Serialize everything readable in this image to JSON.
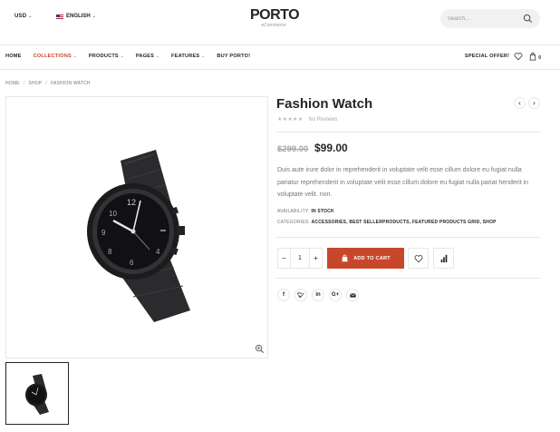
{
  "header": {
    "currency": "USD",
    "language": "ENGLISH",
    "logo": {
      "brand": "PORTO",
      "sub": "eCommerce"
    },
    "search": {
      "placeholder": "Search..."
    }
  },
  "nav": {
    "items": [
      {
        "label": "HOME",
        "has_dropdown": false
      },
      {
        "label": "COLLECTIONS",
        "has_dropdown": true,
        "active": true
      },
      {
        "label": "PRODUCTS",
        "has_dropdown": true
      },
      {
        "label": "PAGES",
        "has_dropdown": true
      },
      {
        "label": "FEATURES",
        "has_dropdown": true
      },
      {
        "label": "BUY PORTO!",
        "has_dropdown": false
      }
    ],
    "special_offers": "SPECIAL OFFER!",
    "cart_count": "0"
  },
  "breadcrumb": [
    "HOME",
    "SHOP",
    "FASHION WATCH"
  ],
  "product": {
    "title": "Fashion Watch",
    "rating": {
      "stars": 0,
      "max": 5,
      "reviews_label": "No Reviews"
    },
    "old_price": "$299.00",
    "price": "$99.00",
    "description": "Duis aute irure dolor in reprehenderit in voluptate velit esse cillum dolore eu fugiat nulla pariatur reprehenderit in voluptate velit esse cillum dolore eu fugiat nulla pariat henderit in voluptate velit. non.",
    "availability_label": "AVAILABILITY:",
    "availability_value": "IN STOCK",
    "categories_label": "CATEGORIES:",
    "categories_value": "ACCESSORIES, BEST SELLERPRODUCTS, FEATURED PRODUCTS GRID, SHOP",
    "quantity": "1",
    "add_to_cart": "ADD TO CART"
  },
  "share": [
    "f",
    "t",
    "in",
    "G+",
    "mail"
  ],
  "colors": {
    "accent": "#c8472b",
    "text": "#222529",
    "muted": "#777777",
    "border": "#e7e7e7"
  }
}
